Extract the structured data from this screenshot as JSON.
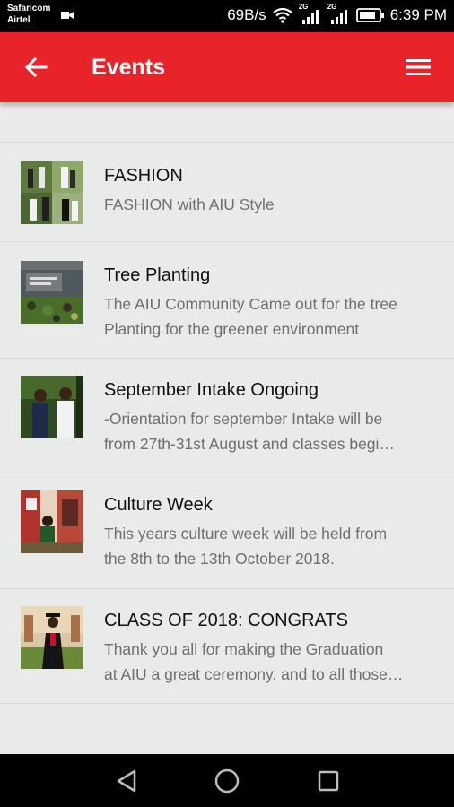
{
  "status_bar": {
    "carrier_1": "Safaricom",
    "carrier_2": "Airtel",
    "net_speed": "69B/s",
    "sig_label_1": "2G",
    "sig_label_2": "2G",
    "time": "6:39 PM",
    "icons": [
      "camera-icon",
      "wifi-icon",
      "signal-icon",
      "battery-icon"
    ]
  },
  "app_bar": {
    "title": "Events",
    "accent_color": "#e8232a",
    "back_icon": "arrow-left-icon",
    "menu_icon": "hamburger-menu-icon"
  },
  "events": [
    {
      "title": "FASHION",
      "desc_lines": [
        "FASHION with AIU Style"
      ],
      "thumb": "fashion-photo"
    },
    {
      "title": "Tree Planting",
      "desc_lines": [
        "The AIU Community Came out for the tree",
        "Planting for the greener environment"
      ],
      "thumb": "tree-planting-photo"
    },
    {
      "title": "September Intake Ongoing",
      "desc_lines": [
        "-Orientation for september Intake will be",
        "from 27th-31st August and classes begi…"
      ],
      "thumb": "intake-photo"
    },
    {
      "title": "Culture Week",
      "desc_lines": [
        "This years culture week will be held from",
        "the 8th to the 13th October 2018."
      ],
      "thumb": "culture-week-photo"
    },
    {
      "title": "CLASS OF 2018: CONGRATS",
      "desc_lines": [
        "Thank you all for making the Graduation",
        "at AIU a great ceremony. and to all those…"
      ],
      "thumb": "graduation-photo"
    }
  ],
  "nav_bar": {
    "icons": [
      "back-triangle-icon",
      "home-circle-icon",
      "recents-square-icon"
    ]
  }
}
